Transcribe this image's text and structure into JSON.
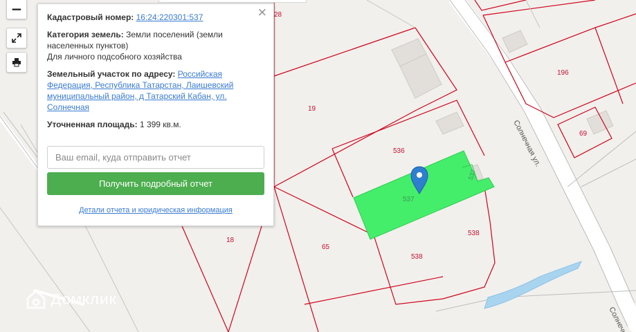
{
  "controls": {
    "zoom_out_glyph": "−",
    "fullscreen_icon": "expand-icon",
    "print_icon": "printer-icon"
  },
  "popup": {
    "cadastral_label": "Кадастровый номер:",
    "cadastral_value": "16:24:220301:537",
    "category_label": "Категория земель:",
    "category_value": "Земли поселений (земли населенных пунктов)",
    "category_extra": "Для личного подсобного хозяйства",
    "address_label": "Земельный участок по адресу:",
    "address_value": "Российская Федерация, Республика Татарстан, Лаишевский муниципальный район, д Татарский Кабан, ул. Солнечная",
    "area_label": "Уточненная площадь:",
    "area_value": "1 399 кв.м.",
    "email_placeholder": "Ваш email, куда отправить отчет",
    "button_label": "Получить подробный отчет",
    "details_link": "Детали отчета и юридическая информация",
    "close_glyph": "×"
  },
  "map": {
    "parcels": {
      "p28": "28",
      "p19": "19",
      "p196": "196",
      "p69": "69",
      "p536": "536",
      "p537": "537",
      "p537_small": "537",
      "p538a": "538",
      "p538b": "538",
      "p65": "65",
      "p18": "18"
    },
    "streets": {
      "solnechnaya1": "Солнечная ул.",
      "solnechnaya2": "Солнечна"
    },
    "colors": {
      "selected_parcel": "#44ee6a",
      "parcel_border": "#d0021b",
      "marker": "#2f7fd1",
      "water": "#a8d4f0"
    }
  },
  "watermark": {
    "brand": "Домклик"
  }
}
